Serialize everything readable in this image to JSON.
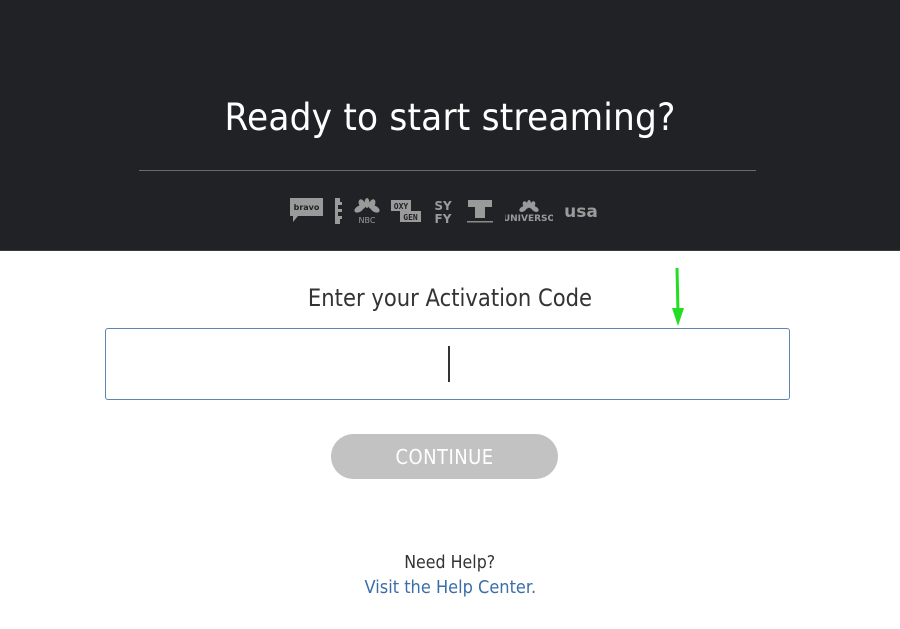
{
  "hero": {
    "title": "Ready to start streaming?",
    "background_color": "#212226",
    "network_logos": [
      {
        "name": "bravo",
        "label": "bravo"
      },
      {
        "name": "e",
        "label": "E!"
      },
      {
        "name": "nbc",
        "label": "NBC"
      },
      {
        "name": "oxygen",
        "label": "OXY GEN"
      },
      {
        "name": "syfy",
        "label": "SY FY"
      },
      {
        "name": "telemundo",
        "label": "T"
      },
      {
        "name": "universo",
        "label": "UNIVERSO"
      },
      {
        "name": "usa",
        "label": "usa"
      }
    ]
  },
  "activation": {
    "label": "Enter your Activation Code",
    "input_value": "",
    "input_placeholder": "",
    "border_color": "#5f86b0"
  },
  "continue_button": {
    "label": "CONTINUE",
    "disabled": true,
    "background_color": "#c2c2c2"
  },
  "help": {
    "prompt": "Need Help?",
    "link_text": "Visit the Help Center.",
    "link_color": "#3b6ea8"
  },
  "annotation": {
    "arrow_color": "#22dd22",
    "arrow_direction": "down"
  }
}
